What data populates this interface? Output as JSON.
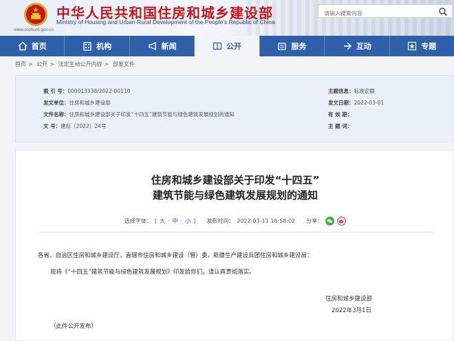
{
  "header": {
    "title": "中华人民共和国住房和城乡建设部",
    "subtitle": "Ministry of Housing and Urban-Rural Development of the People's Republic of China",
    "url": "www.mohurd.gov.cn",
    "search_placeholder": "请输入搜索内容"
  },
  "nav": {
    "items": [
      {
        "label": "首页",
        "icon": "home-icon"
      },
      {
        "label": "机构",
        "icon": "building-icon"
      },
      {
        "label": "新闻",
        "icon": "megaphone-icon"
      },
      {
        "label": "公开",
        "icon": "open-book-icon",
        "active": true
      },
      {
        "label": "服务",
        "icon": "service-icon"
      },
      {
        "label": "互动",
        "icon": "interact-icon"
      },
      {
        "label": "专题",
        "icon": "star-icon"
      }
    ]
  },
  "breadcrumb": [
    "首页",
    "公开",
    "法定主动公开内容",
    "部发文件"
  ],
  "info": {
    "index_key": "索  引  号：",
    "index_val": "000013338/2022-00110",
    "issuer_key": "发文单位：",
    "issuer_val": "住房和城乡建设部",
    "docname_key": "文件名称：",
    "docname_val": "住房和城乡建设部关于印发“十四五”建筑节能与绿色建筑发展规划的通知",
    "docno_key": "文        号：",
    "docno_val": "建标〔2022〕24号",
    "category_key": "主题信息：",
    "category_val": "标准定额",
    "date_key": "发文日期：",
    "date_val": "2022-03-01",
    "valid_key": "有  效  期：",
    "valid_val": "",
    "keywords_key": "主  题  词：",
    "keywords_val": ""
  },
  "article": {
    "title_line1": "住房和城乡建设部关于印发“十四五”",
    "title_line2": "建筑节能与绿色建筑发展规划的通知",
    "font_label": "选择字体：",
    "font_open": "[",
    "font_large": "大",
    "font_sep1": "·",
    "font_medium": "中",
    "font_sep2": "·",
    "font_small": "小",
    "font_close": "]",
    "publish_label": "发布时间：",
    "publish_time": "2022-03-11 16:58:02",
    "share_label": "分享：",
    "salutation": "各省、自治区住房和城乡建设厅，直辖市住房和城乡建设（管）委，新疆生产建设兵团住房和城乡建设局：",
    "paragraph": "现将《“十四五”建筑节能与绿色建筑发展规划》印发给你们，请认真贯彻落实。",
    "signature": "住房和城乡建设部",
    "sign_date": "2022年3月1日",
    "public_note": "（此件公开发布）"
  },
  "colors": {
    "brand_red": "#c8161d",
    "nav_blue": "#2e5fa8",
    "wechat_green": "#3cb034",
    "weibo_red": "#e6162d"
  }
}
